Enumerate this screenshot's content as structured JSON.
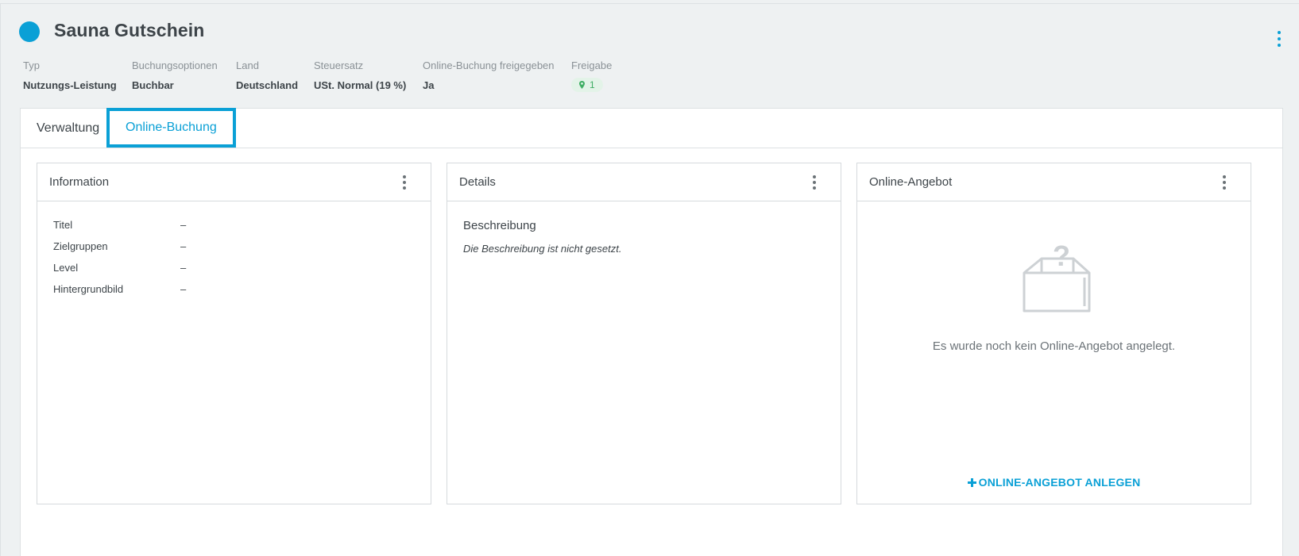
{
  "header": {
    "title": "Sauna Gutschein",
    "status_color": "#0aa0d6",
    "more_icon": "kebab-icon"
  },
  "meta": {
    "typ": {
      "label": "Typ",
      "value": "Nutzungs-Leistung"
    },
    "buchungsoptionen": {
      "label": "Buchungsoptionen",
      "value": "Buchbar"
    },
    "land": {
      "label": "Land",
      "value": "Deutschland"
    },
    "steuersatz": {
      "label": "Steuersatz",
      "value": "USt. Normal (19 %)"
    },
    "online_buchung": {
      "label": "Online-Buchung freigegeben",
      "value": "Ja"
    },
    "freigabe": {
      "label": "Freigabe",
      "value": "1",
      "icon": "location-pin-icon"
    }
  },
  "tabs": [
    {
      "label": "Verwaltung",
      "active": false
    },
    {
      "label": "Online-Buchung",
      "active": true
    }
  ],
  "cards": {
    "information": {
      "title": "Information",
      "rows": [
        {
          "label": "Titel",
          "value": "–"
        },
        {
          "label": "Zielgruppen",
          "value": "–"
        },
        {
          "label": "Level",
          "value": "–"
        },
        {
          "label": "Hintergrundbild",
          "value": "–"
        }
      ]
    },
    "details": {
      "title": "Details",
      "heading": "Beschreibung",
      "text": "Die Beschreibung ist nicht gesetzt."
    },
    "online_angebot": {
      "title": "Online-Angebot",
      "empty_icon": "empty-box-question-icon",
      "empty_text": "Es wurde noch kein Online-Angebot angelegt.",
      "create_label": "ONLINE-ANGEBOT ANLEGEN",
      "create_icon": "plus-icon"
    }
  },
  "colors": {
    "accent": "#0aa0d6",
    "badge_green": "#3fae64",
    "badge_bg": "#e3f3e8"
  }
}
